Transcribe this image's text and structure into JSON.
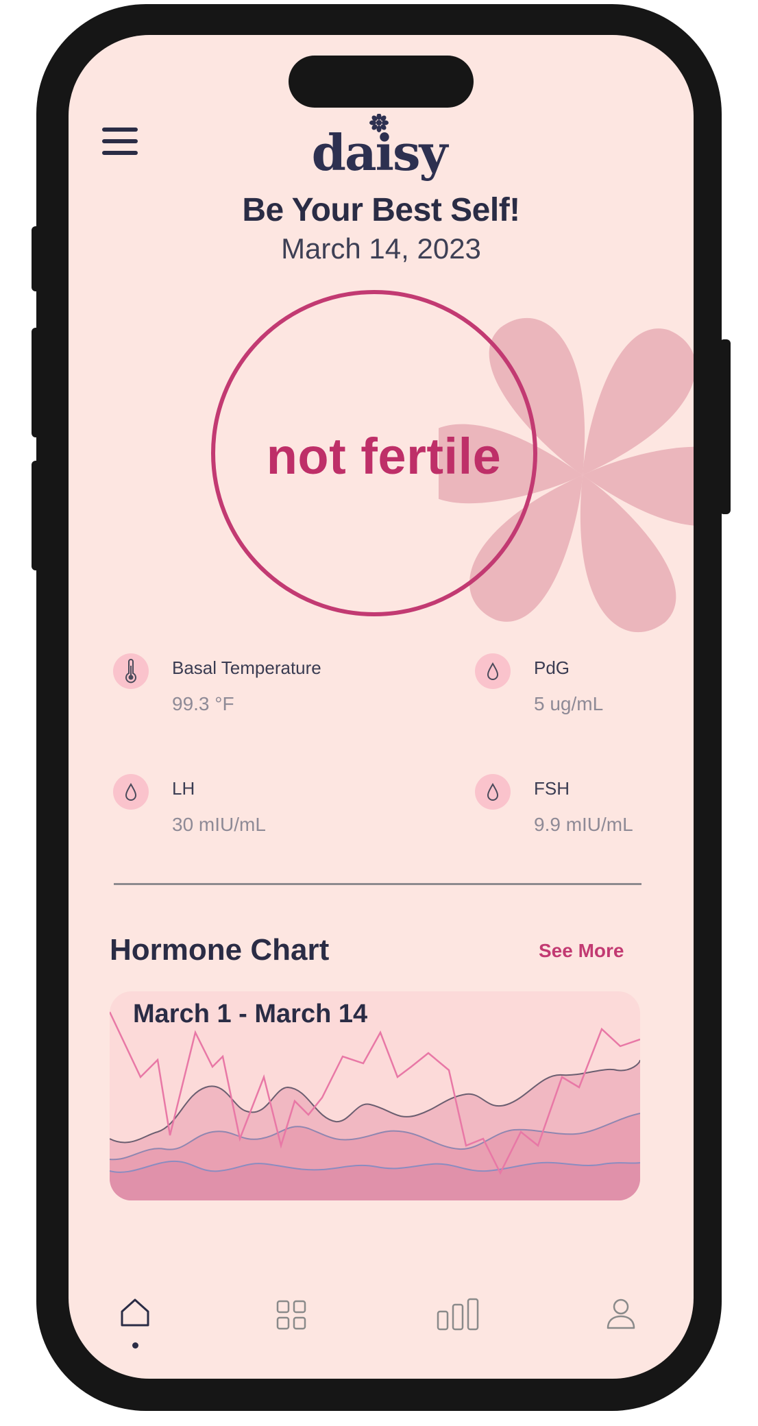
{
  "app": {
    "name": "daisy"
  },
  "header": {
    "greeting": "Be Your Best Self!",
    "date": "March 14, 2023"
  },
  "status": {
    "label": "not fertile"
  },
  "metrics": [
    {
      "icon": "thermometer-icon",
      "label": "Basal Temperature",
      "value": "99.3 °F"
    },
    {
      "icon": "droplet-icon",
      "label": "PdG",
      "value": "5 ug/mL"
    },
    {
      "icon": "droplet-icon",
      "label": "LH",
      "value": "30 mIU/mL"
    },
    {
      "icon": "droplet-icon",
      "label": "FSH",
      "value": "9.9 mIU/mL"
    }
  ],
  "hormone_chart": {
    "title": "Hormone Chart",
    "see_more_label": "See More",
    "range_label": "March 1 - March 14"
  },
  "bottom_nav": {
    "items": [
      {
        "icon": "home-icon",
        "active": true
      },
      {
        "icon": "grid-icon",
        "active": false
      },
      {
        "icon": "bar-chart-icon",
        "active": false
      },
      {
        "icon": "profile-icon",
        "active": false
      }
    ]
  },
  "colors": {
    "background": "#fde6e1",
    "accent": "#c23a72",
    "text_dark": "#2a2c45",
    "icon_bg": "#fac3cc",
    "flower": "#ebb6bc"
  }
}
